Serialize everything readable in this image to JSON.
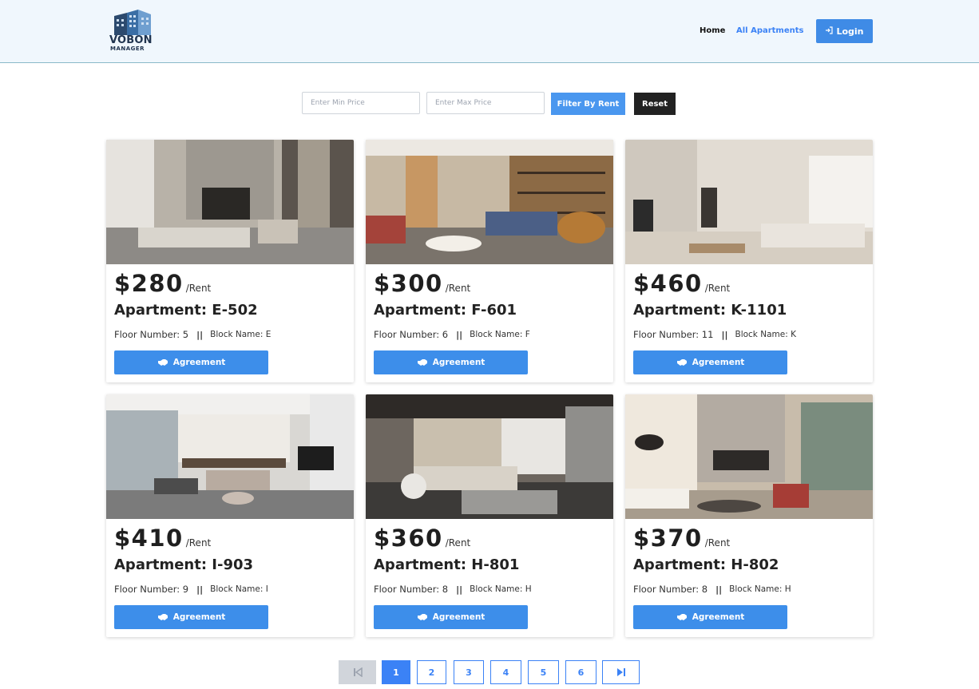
{
  "header": {
    "logo_line1": "VOBON",
    "logo_line2": "MANAGER",
    "nav": {
      "home": "Home",
      "all_apartments": "All Apartments"
    },
    "login_label": "Login"
  },
  "filter": {
    "min_placeholder": "Enter Min Price",
    "max_placeholder": "Enter Max Price",
    "filter_label": "Filter By Rent",
    "reset_label": "Reset"
  },
  "apartments": [
    {
      "price": "$280",
      "per": "/Rent",
      "title": "Apartment: E-502",
      "floor": "Floor Number: 5",
      "separator": "||",
      "block": "Block Name: E",
      "button": "Agreement"
    },
    {
      "price": "$300",
      "per": "/Rent",
      "title": "Apartment: F-601",
      "floor": "Floor Number: 6",
      "separator": "||",
      "block": "Block Name: F",
      "button": "Agreement"
    },
    {
      "price": "$460",
      "per": "/Rent",
      "title": "Apartment: K-1101",
      "floor": "Floor Number: 11",
      "separator": "||",
      "block": "Block Name: K",
      "button": "Agreement"
    },
    {
      "price": "$410",
      "per": "/Rent",
      "title": "Apartment: I-903",
      "floor": "Floor Number: 9",
      "separator": "||",
      "block": "Block Name: I",
      "button": "Agreement"
    },
    {
      "price": "$360",
      "per": "/Rent",
      "title": "Apartment: H-801",
      "floor": "Floor Number: 8",
      "separator": "||",
      "block": "Block Name: H",
      "button": "Agreement"
    },
    {
      "price": "$370",
      "per": "/Rent",
      "title": "Apartment: H-802",
      "floor": "Floor Number: 8",
      "separator": "||",
      "block": "Block Name: H",
      "button": "Agreement"
    }
  ],
  "pagination": {
    "pages": [
      "1",
      "2",
      "3",
      "4",
      "5",
      "6"
    ],
    "current": "1",
    "first_icon": "first-page-icon",
    "last_icon": "last-page-icon"
  },
  "colors": {
    "accent": "#3d8eea",
    "header_bg": "#f0f7fd",
    "dark_button": "#222222"
  }
}
